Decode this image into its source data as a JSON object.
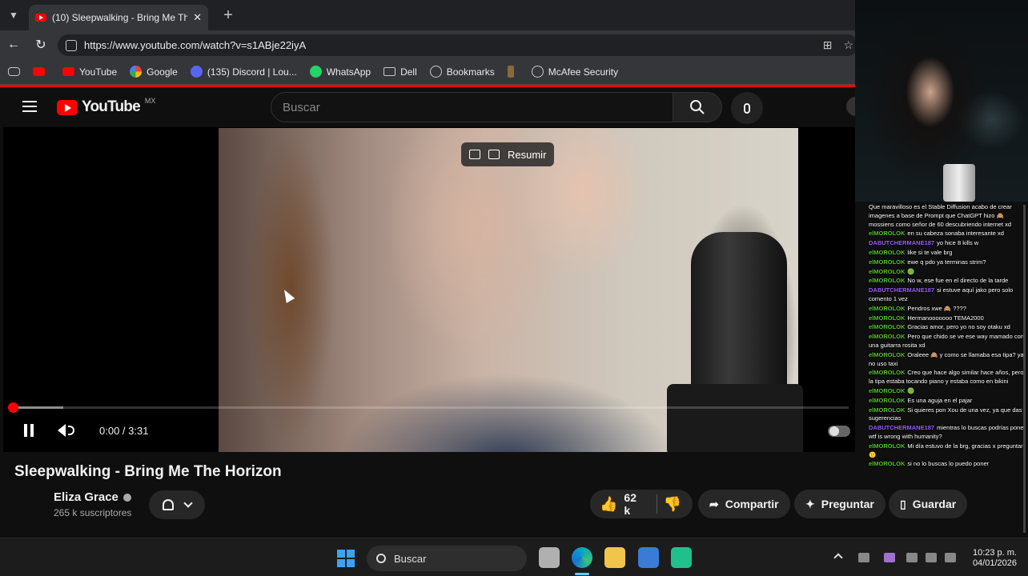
{
  "browser": {
    "tab_title": "(10) Sleepwalking - Bring Me The H",
    "tab_close": "✕",
    "new_tab": "+",
    "url": "https://www.youtube.com/watch?v=s1ABje22iyA",
    "bookmarks": [
      {
        "label": "",
        "icon": "youtube-icon"
      },
      {
        "label": "YouTube",
        "icon": "youtube-icon"
      },
      {
        "label": "Google",
        "icon": "google-icon"
      },
      {
        "label": "(135) Discord | Lou...",
        "icon": "discord-icon"
      },
      {
        "label": "WhatsApp",
        "icon": "whatsapp-icon"
      },
      {
        "label": "Dell",
        "icon": "folder-icon"
      },
      {
        "label": "Bookmarks",
        "icon": "globe-icon"
      },
      {
        "label": "",
        "icon": "extension-icon"
      },
      {
        "label": "McAfee Security",
        "icon": "globe-icon"
      }
    ]
  },
  "youtube": {
    "logo_text": "YouTube",
    "country_code": "MX",
    "search_placeholder": "Buscar",
    "summarize_label": "Resumir",
    "time_display": "0:00 / 3:31",
    "progress_buffered_fraction": 0.06,
    "video_title": "Sleepwalking - Bring Me The Horizon",
    "channel_name": "Eliza Grace",
    "subscribers": "265 k suscriptores",
    "like_count": "62 k",
    "share_label": "Compartir",
    "ask_label": "Preguntar",
    "save_label": "Guardar"
  },
  "chat": {
    "messages": [
      {
        "user": "",
        "text": "Que maravilloso es el Stable Diffusion acabo de crear imagenes a base de Prompt que ChatGPT hizo 🙈 mossiens como señor de 60 descubriendo internet xd"
      },
      {
        "user": "elMOROLOK",
        "text": "en su cabeza sonaba interesante xd"
      },
      {
        "user": "DABUTCHERMANE187",
        "text": "yo hice 8 kills w"
      },
      {
        "user": "elMOROLOK",
        "text": "like si te vale brg"
      },
      {
        "user": "elMOROLOK",
        "text": "ewe q pdo ya terminas strim?"
      },
      {
        "user": "elMOROLOK",
        "text": "🟢"
      },
      {
        "user": "elMOROLOK",
        "text": "No w, ese fue en el directo de la tarde"
      },
      {
        "user": "DABUTCHERMANE187",
        "text": "si estuve aquí jako pero solo comento 1 vez"
      },
      {
        "user": "elMOROLOK",
        "text": "Pendros xwe 🙈 ????"
      },
      {
        "user": "elMOROLOK",
        "text": "Hermanooooooo TEMA2000"
      },
      {
        "user": "elMOROLOK",
        "text": "Gracias amor, pero yo no soy otaku xd"
      },
      {
        "user": "elMOROLOK",
        "text": "Pero que chido se ve ese way mamado con una guitarra rosita xd"
      },
      {
        "user": "elMOROLOK",
        "text": "Oraleee 🙈 y como se llamaba esa tipa? ya no uso taxi"
      },
      {
        "user": "elMOROLOK",
        "text": "Creo que hace algo similar hace años, pero la tipa estaba tocando piano y estaba como en bikini"
      },
      {
        "user": "elMOROLOK",
        "text": "🟢"
      },
      {
        "user": "elMOROLOK",
        "text": "Es una aguja en el pajar"
      },
      {
        "user": "elMOROLOK",
        "text": "Si quieres pon Xou de una vez, ya que das sugerencias"
      },
      {
        "user": "DABUTCHERMANE187",
        "text": "mientras lo buscas podrías poner wtf is wrong with humanity?"
      },
      {
        "user": "elMOROLOK",
        "text": "Mi día estuvo de la brg, gracias x preguntar 🙂"
      },
      {
        "user": "elMOROLOK",
        "text": "si no lo buscas lo puedo poner"
      }
    ]
  },
  "taskbar": {
    "search_label": "Buscar",
    "time": "10:23 p. m.",
    "date": "04/01/2026"
  },
  "colors": {
    "accent_red": "#ff0000",
    "chat_user": "#52c22b",
    "chat_user_alt": "#9b5cff"
  }
}
